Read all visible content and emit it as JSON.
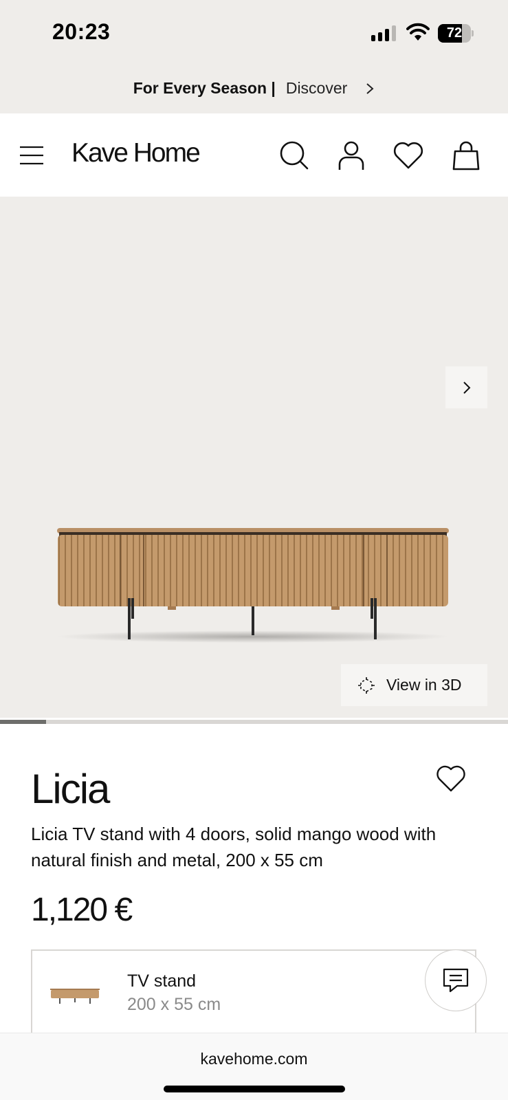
{
  "status_bar": {
    "time": "20:23",
    "battery": "72",
    "battery_level": 0.72
  },
  "promo": {
    "bold_text": "For Every Season |",
    "link_text": "Discover"
  },
  "header": {
    "logo": "Kave Home"
  },
  "gallery": {
    "view_3d_label": "View in 3D",
    "progress": 0.09
  },
  "product": {
    "title": "Licia",
    "description": "Licia TV stand with 4 doors, solid mango wood with natural finish and metal, 200 x 55 cm",
    "price": "1,120 €"
  },
  "variant": {
    "name": "TV stand",
    "size": "200 x 55 cm"
  },
  "browser": {
    "url": "kavehome.com"
  },
  "colors": {
    "page_bg": "#ffffff",
    "gallery_bg": "#efedea",
    "wood": "#c49a6c",
    "text": "#111111"
  },
  "icons": [
    "menu-icon",
    "search-icon",
    "account-icon",
    "heart-icon",
    "bag-icon",
    "chevron-right-icon",
    "view-3d-icon",
    "chat-icon"
  ]
}
